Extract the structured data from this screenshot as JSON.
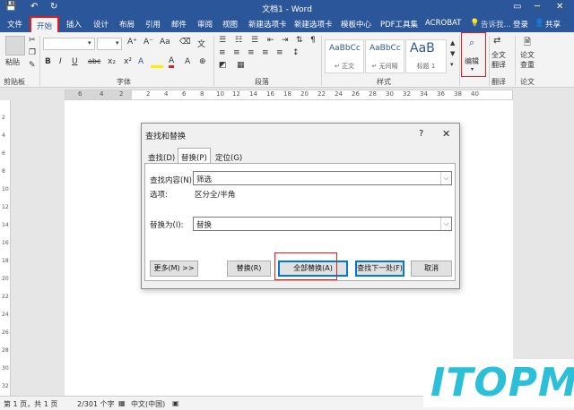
{
  "window": {
    "title": "文档1 - Word",
    "restore_icon": "▭",
    "minimize_icon": "─",
    "close_icon": "✕",
    "qat_save": "💾",
    "qat_undo": "↶",
    "qat_redo": "↻"
  },
  "tabs": [
    "文件",
    "开始",
    "插入",
    "设计",
    "布局",
    "引用",
    "邮件",
    "审阅",
    "视图",
    "新建选项卡",
    "新建选项卡",
    "模板中心",
    "PDF工具集",
    "ACROBAT"
  ],
  "tell_me": "告诉我...",
  "login": "登录",
  "share": "共享",
  "ribbon": {
    "paste_label": "粘贴",
    "clipboard_group": "剪贴板",
    "font_group": "字体",
    "paragraph_group": "段落",
    "styles_group": "样式",
    "editing_label": "编辑",
    "translate_label1": "全文",
    "translate_label2": "翻译",
    "translate_group": "翻译",
    "paper_label1": "论文",
    "paper_label2": "查重",
    "paper_group": "论文",
    "styles": [
      {
        "sample": "AaBbCc",
        "name": "↵ 正文"
      },
      {
        "sample": "AaBbCc",
        "name": "↵ 无间隔"
      },
      {
        "sample": "AaB",
        "name": "标题 1"
      }
    ],
    "bold": "B",
    "italic": "I",
    "underline": "U",
    "strike": "abc",
    "sub": "x₂",
    "sup": "x²",
    "font_color_a": "A"
  },
  "ruler": {
    "numbers": [
      "6",
      "4",
      "2",
      "",
      "2",
      "4",
      "6",
      "8",
      "10",
      "12",
      "14",
      "16",
      "18",
      "20",
      "22",
      "24",
      "26",
      "28",
      "30",
      "32",
      "34",
      "36",
      "38",
      "40"
    ],
    "vnumbers": [
      "2",
      "4",
      "6",
      "8",
      "10",
      "12",
      "14",
      "16",
      "18",
      "20",
      "22",
      "24",
      "26",
      "28",
      "30",
      "32"
    ]
  },
  "dialog": {
    "title": "查找和替换",
    "help": "?",
    "close": "✕",
    "tabs": [
      "查找(D)",
      "替换(P)",
      "定位(G)"
    ],
    "find_label": "查找内容(N):",
    "find_value": "筛选",
    "options_label": "选项:",
    "options_value": "区分全/半角",
    "replace_label": "替换为(I):",
    "replace_value": "替换",
    "more_button": "更多(M) >>",
    "replace_button": "替换(R)",
    "replace_all_button": "全部替换(A)",
    "find_next_button": "查找下一处(F)",
    "cancel_button": "取消",
    "dropdown_icon": "⌵"
  },
  "status": {
    "page": "第 1 页，共 1 页",
    "words": "2/301 个字",
    "language": "中文(中国)"
  },
  "watermark": "ITOPM"
}
